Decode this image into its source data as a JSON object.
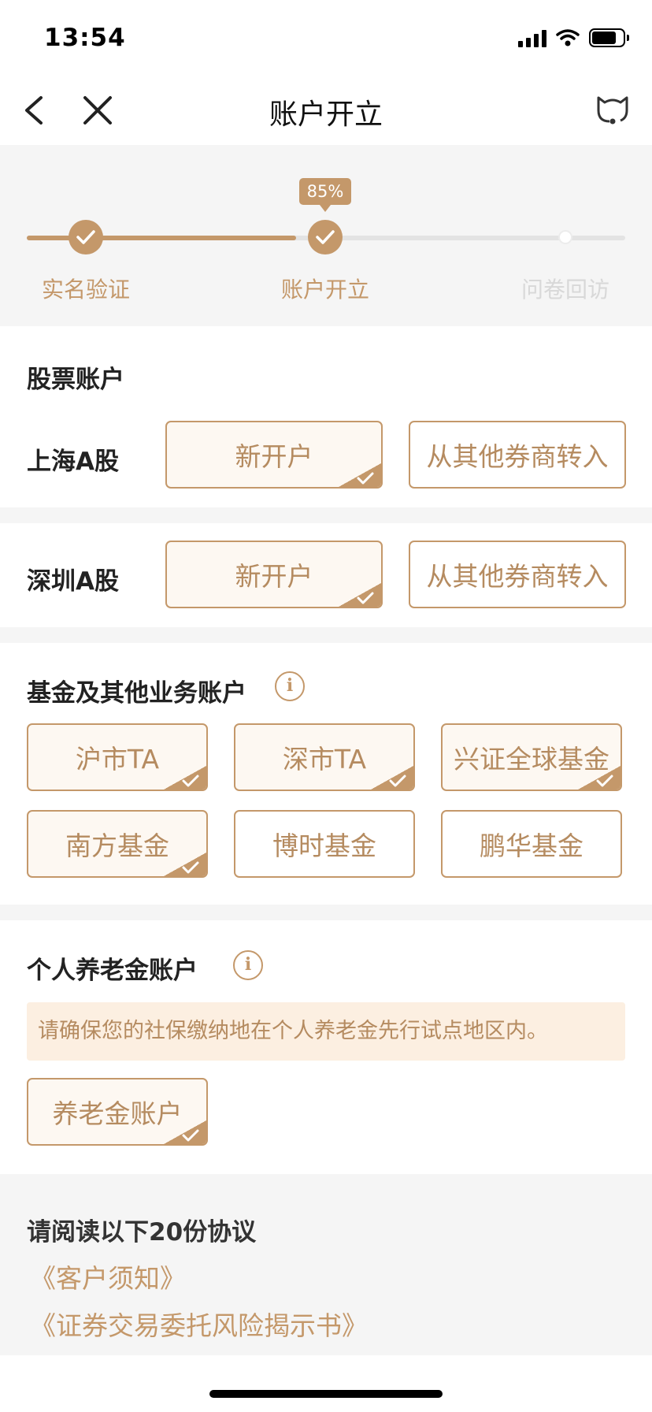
{
  "status_bar": {
    "time": "13:54"
  },
  "nav": {
    "title": "账户开立"
  },
  "progress": {
    "percent_label": "85%",
    "fraction": 0.45,
    "steps": [
      {
        "label": "实名验证",
        "state": "done"
      },
      {
        "label": "账户开立",
        "state": "current"
      },
      {
        "label": "问卷回访",
        "state": "pending"
      }
    ]
  },
  "stock_account": {
    "title": "股票账户",
    "rows": [
      {
        "label": "上海A股",
        "options": [
          {
            "label": "新开户",
            "selected": true
          },
          {
            "label": "从其他券商转入",
            "selected": false
          }
        ]
      },
      {
        "label": "深圳A股",
        "options": [
          {
            "label": "新开户",
            "selected": true
          },
          {
            "label": "从其他券商转入",
            "selected": false
          }
        ]
      }
    ]
  },
  "fund_account": {
    "title": "基金及其他业务账户",
    "options": [
      {
        "label": "沪市TA",
        "selected": true
      },
      {
        "label": "深市TA",
        "selected": true
      },
      {
        "label": "兴证全球基金",
        "selected": true
      },
      {
        "label": "南方基金",
        "selected": true
      },
      {
        "label": "博时基金",
        "selected": false
      },
      {
        "label": "鹏华基金",
        "selected": false
      }
    ]
  },
  "pension_account": {
    "title": "个人养老金账户",
    "notice": "请确保您的社保缴纳地在个人养老金先行试点地区内。",
    "options": [
      {
        "label": "养老金账户",
        "selected": true
      }
    ]
  },
  "agreements": {
    "title": "请阅读以下20份协议",
    "items": [
      "《客户须知》",
      "《证券交易委托风险揭示书》"
    ]
  },
  "colors": {
    "accent": "#c4986a",
    "accent_text": "#b58b60",
    "notice_bg": "#fcefe1",
    "page_bg": "#f5f5f5"
  }
}
